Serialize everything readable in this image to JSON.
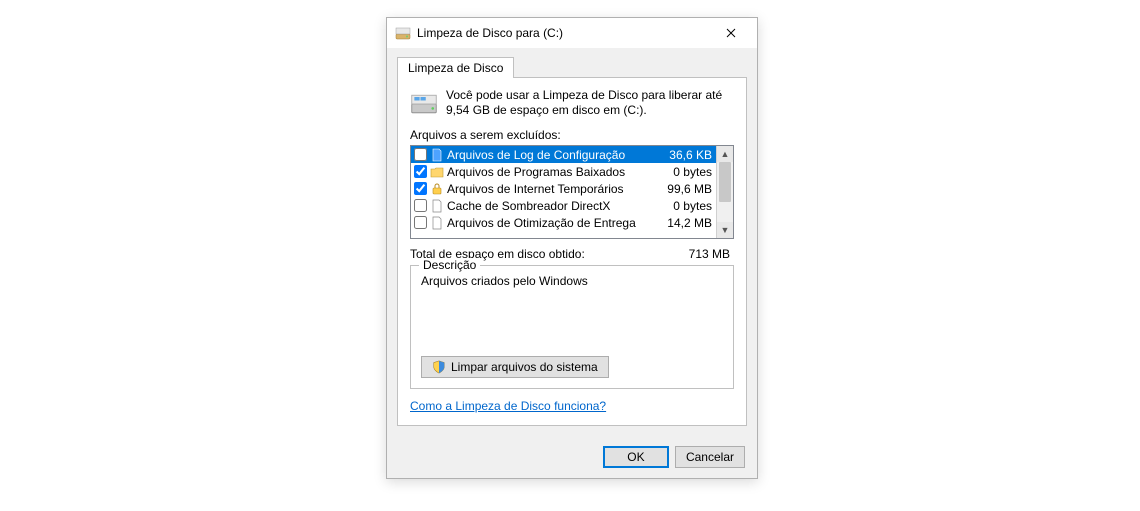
{
  "window": {
    "title": "Limpeza de Disco para  (C:)"
  },
  "tab": {
    "label": "Limpeza de Disco"
  },
  "intro": "Você pode usar a Limpeza de Disco para liberar até 9,54 GB de espaço em disco em  (C:).",
  "files_label": "Arquivos a serem excluídos:",
  "items": [
    {
      "icon": "file-blue",
      "label": "Arquivos de Log de Configuração",
      "size": "36,6 KB",
      "checked": false,
      "selected": true
    },
    {
      "icon": "folder-yellow",
      "label": "Arquivos de Programas Baixados",
      "size": "0 bytes",
      "checked": true,
      "selected": false
    },
    {
      "icon": "lock-yellow",
      "label": "Arquivos de Internet Temporários",
      "size": "99,6 MB",
      "checked": true,
      "selected": false
    },
    {
      "icon": "file-white",
      "label": "Cache de Sombreador DirectX",
      "size": "0 bytes",
      "checked": false,
      "selected": false
    },
    {
      "icon": "file-white",
      "label": "Arquivos de Otimização de Entrega",
      "size": "14,2 MB",
      "checked": false,
      "selected": false
    }
  ],
  "total": {
    "label": "Total de espaço em disco obtido:",
    "value": "713 MB"
  },
  "description": {
    "legend": "Descrição",
    "text": "Arquivos criados pelo Windows"
  },
  "clean_system_btn": "Limpar arquivos do sistema",
  "help_link": "Como a Limpeza de Disco funciona?",
  "buttons": {
    "ok": "OK",
    "cancel": "Cancelar"
  }
}
